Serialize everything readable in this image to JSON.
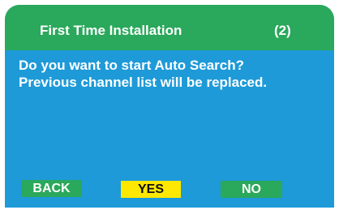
{
  "dialog": {
    "title": "First Time Installation",
    "step": "(2)",
    "message_lines": [
      "Do you want to start Auto Search?",
      "Previous channel list will be replaced."
    ],
    "buttons": {
      "back": "BACK",
      "yes": "YES",
      "no": "NO"
    },
    "selected_button": "yes"
  },
  "colors": {
    "title_bar": "#2aa85b",
    "body": "#1e9ad8",
    "green_button": "#2aa85b",
    "selected_button": "#ffe800",
    "text": "#ffffff"
  }
}
